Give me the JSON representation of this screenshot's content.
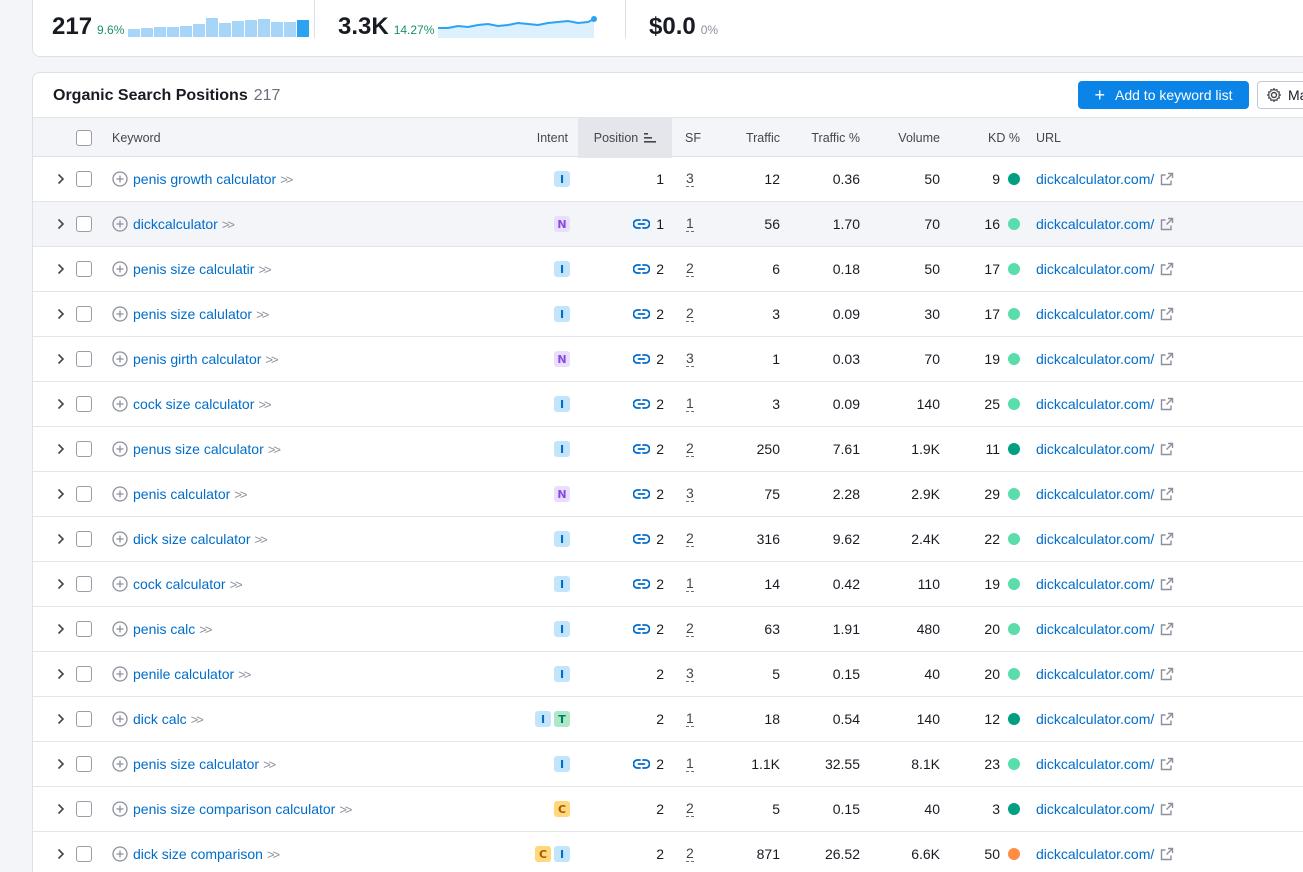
{
  "summary": {
    "keywords": {
      "value": "217",
      "change": "9.6%",
      "bars": [
        0.4,
        0.45,
        0.5,
        0.5,
        0.55,
        0.65,
        0.95,
        0.7,
        0.8,
        0.85,
        0.9,
        0.75,
        0.75,
        0.85
      ]
    },
    "traffic": {
      "value": "3.3K",
      "change": "14.27%"
    },
    "cost": {
      "value": "$0.0",
      "change": "0%"
    }
  },
  "colors": {
    "accent": "#0b84e8",
    "link": "#006dca",
    "kd_easy": "#59ddaa",
    "kd_very_easy": "#009f81",
    "kd_hard": "#ff8c43"
  },
  "table": {
    "title": "Organic Search Positions",
    "count": "217",
    "add_button": "Add to keyword list",
    "manage_button": "Ma",
    "columns": {
      "keyword": "Keyword",
      "intent": "Intent",
      "position": "Position",
      "sf": "SF",
      "traffic": "Traffic",
      "traffic_pct": "Traffic %",
      "volume": "Volume",
      "kd": "KD %",
      "url": "URL"
    },
    "rows": [
      {
        "keyword": "penis growth calculator",
        "intents": [
          "I"
        ],
        "link": false,
        "position": "1",
        "sf": "3",
        "traffic": "12",
        "traffic_pct": "0.36",
        "volume": "50",
        "kd": "9",
        "kd_color": "#009f81",
        "url": "dickcalculator.com/"
      },
      {
        "keyword": "dickcalculator",
        "intents": [
          "N"
        ],
        "link": true,
        "position": "1",
        "sf": "1",
        "traffic": "56",
        "traffic_pct": "1.70",
        "volume": "70",
        "kd": "16",
        "kd_color": "#59ddaa",
        "url": "dickcalculator.com/"
      },
      {
        "keyword": "penis size calculatir",
        "intents": [
          "I"
        ],
        "link": true,
        "position": "2",
        "sf": "2",
        "traffic": "6",
        "traffic_pct": "0.18",
        "volume": "50",
        "kd": "17",
        "kd_color": "#59ddaa",
        "url": "dickcalculator.com/"
      },
      {
        "keyword": "penis size calulator",
        "intents": [
          "I"
        ],
        "link": true,
        "position": "2",
        "sf": "2",
        "traffic": "3",
        "traffic_pct": "0.09",
        "volume": "30",
        "kd": "17",
        "kd_color": "#59ddaa",
        "url": "dickcalculator.com/"
      },
      {
        "keyword": "penis girth calculator",
        "intents": [
          "N"
        ],
        "link": true,
        "position": "2",
        "sf": "3",
        "traffic": "1",
        "traffic_pct": "0.03",
        "volume": "70",
        "kd": "19",
        "kd_color": "#59ddaa",
        "url": "dickcalculator.com/"
      },
      {
        "keyword": "cock size calculator",
        "intents": [
          "I"
        ],
        "link": true,
        "position": "2",
        "sf": "1",
        "traffic": "3",
        "traffic_pct": "0.09",
        "volume": "140",
        "kd": "25",
        "kd_color": "#59ddaa",
        "url": "dickcalculator.com/"
      },
      {
        "keyword": "penus size calculator",
        "intents": [
          "I"
        ],
        "link": true,
        "position": "2",
        "sf": "2",
        "traffic": "250",
        "traffic_pct": "7.61",
        "volume": "1.9K",
        "kd": "11",
        "kd_color": "#009f81",
        "url": "dickcalculator.com/"
      },
      {
        "keyword": "penis calculator",
        "intents": [
          "N"
        ],
        "link": true,
        "position": "2",
        "sf": "3",
        "traffic": "75",
        "traffic_pct": "2.28",
        "volume": "2.9K",
        "kd": "29",
        "kd_color": "#59ddaa",
        "url": "dickcalculator.com/"
      },
      {
        "keyword": "dick size calculator",
        "intents": [
          "I"
        ],
        "link": true,
        "position": "2",
        "sf": "2",
        "traffic": "316",
        "traffic_pct": "9.62",
        "volume": "2.4K",
        "kd": "22",
        "kd_color": "#59ddaa",
        "url": "dickcalculator.com/"
      },
      {
        "keyword": "cock calculator",
        "intents": [
          "I"
        ],
        "link": true,
        "position": "2",
        "sf": "1",
        "traffic": "14",
        "traffic_pct": "0.42",
        "volume": "110",
        "kd": "19",
        "kd_color": "#59ddaa",
        "url": "dickcalculator.com/"
      },
      {
        "keyword": "penis calc",
        "intents": [
          "I"
        ],
        "link": true,
        "position": "2",
        "sf": "2",
        "traffic": "63",
        "traffic_pct": "1.91",
        "volume": "480",
        "kd": "20",
        "kd_color": "#59ddaa",
        "url": "dickcalculator.com/"
      },
      {
        "keyword": "penile calculator",
        "intents": [
          "I"
        ],
        "link": false,
        "position": "2",
        "sf": "3",
        "traffic": "5",
        "traffic_pct": "0.15",
        "volume": "40",
        "kd": "20",
        "kd_color": "#59ddaa",
        "url": "dickcalculator.com/"
      },
      {
        "keyword": "dick calc",
        "intents": [
          "I",
          "T"
        ],
        "link": false,
        "position": "2",
        "sf": "1",
        "traffic": "18",
        "traffic_pct": "0.54",
        "volume": "140",
        "kd": "12",
        "kd_color": "#009f81",
        "url": "dickcalculator.com/"
      },
      {
        "keyword": "penis size calculator",
        "intents": [
          "I"
        ],
        "link": true,
        "position": "2",
        "sf": "1",
        "traffic": "1.1K",
        "traffic_pct": "32.55",
        "volume": "8.1K",
        "kd": "23",
        "kd_color": "#59ddaa",
        "url": "dickcalculator.com/"
      },
      {
        "keyword": "penis size comparison calculator",
        "intents": [
          "C"
        ],
        "link": false,
        "position": "2",
        "sf": "2",
        "traffic": "5",
        "traffic_pct": "0.15",
        "volume": "40",
        "kd": "3",
        "kd_color": "#009f81",
        "url": "dickcalculator.com/"
      },
      {
        "keyword": "dick size comparison",
        "intents": [
          "C",
          "I"
        ],
        "link": false,
        "position": "2",
        "sf": "2",
        "traffic": "871",
        "traffic_pct": "26.52",
        "volume": "6.6K",
        "kd": "50",
        "kd_color": "#ff8c43",
        "url": "dickcalculator.com/"
      }
    ]
  }
}
